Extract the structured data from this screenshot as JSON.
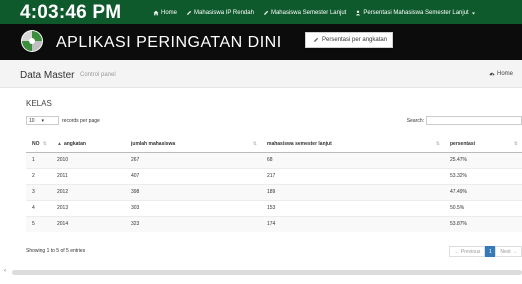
{
  "topbar": {
    "clock": "4:03:46 PM",
    "nav": [
      {
        "label": "Home",
        "icon": "home-icon"
      },
      {
        "label": "Mahasiswa IP Rendah",
        "icon": "edit-icon"
      },
      {
        "label": "Mahasiswa Semester Lanjut",
        "icon": "edit-icon"
      },
      {
        "label": "Persentasi Mahasiswa Semester Lanjut",
        "icon": "user-icon"
      }
    ],
    "dropdown_item": "Persentasi per angkatan"
  },
  "banner": {
    "title": "APLIKASI PERINGATAN DINI"
  },
  "header": {
    "title": "Data Master",
    "subtitle": "Control panel",
    "breadcrumb": "Home"
  },
  "box": {
    "title": "KELAS",
    "length_value": "10",
    "length_suffix": "records per page",
    "search_label": "Search:",
    "columns": [
      "NO",
      "angkatan",
      "jumlah mahasiswa",
      "mahasiswa semester lanjut",
      "persentasi"
    ],
    "rows": [
      [
        "1",
        "2010",
        "267",
        "68",
        "25.47%"
      ],
      [
        "2",
        "2011",
        "407",
        "217",
        "53.32%"
      ],
      [
        "3",
        "2012",
        "398",
        "189",
        "47.49%"
      ],
      [
        "4",
        "2013",
        "303",
        "153",
        "50.5%"
      ],
      [
        "5",
        "2014",
        "323",
        "174",
        "53.87%"
      ]
    ],
    "info": "Showing 1 to 5 of 5 entries",
    "prev": "← Previous",
    "page": "1",
    "next": "Next →"
  },
  "colors": {
    "topbar": "#0f5a2c",
    "banner": "#0c0c0c",
    "accent": "#337ab7"
  }
}
